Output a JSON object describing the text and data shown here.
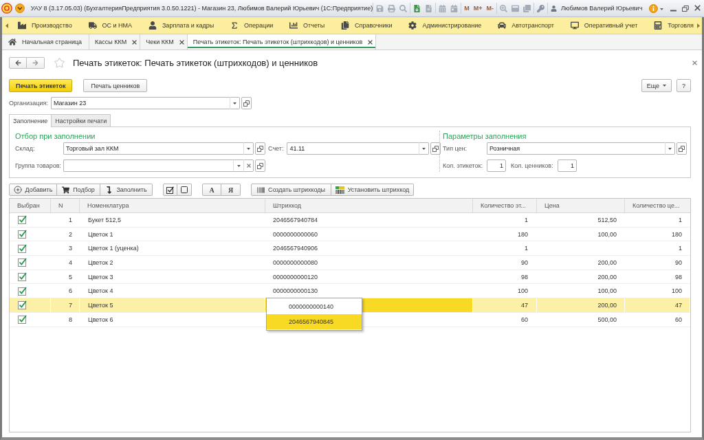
{
  "window": {
    "title": "УАУ 8 (3.17.05.03) (БухгалтерияПредприятия 3.0.50.1221) - Магазин 23, Любимов Валерий Юрьевич (1С:Предприятие)",
    "memory_buttons": [
      "M",
      "M+",
      "M-"
    ],
    "user": "Любимов Валерий Юрьевич"
  },
  "menu": [
    {
      "label": "Производство"
    },
    {
      "label": "ОС и НМА"
    },
    {
      "label": "Зарплата и кадры"
    },
    {
      "label": "Операции"
    },
    {
      "label": "Отчеты"
    },
    {
      "label": "Справочники"
    },
    {
      "label": "Администрирование"
    },
    {
      "label": "Автотранспорт"
    },
    {
      "label": "Оперативный учет"
    },
    {
      "label": "Торговля"
    }
  ],
  "tabs": [
    {
      "label": "Начальная страница",
      "kind": "home",
      "selected": false
    },
    {
      "label": "Кассы ККМ",
      "kind": "document",
      "selected": false
    },
    {
      "label": "Чеки ККМ",
      "kind": "document",
      "selected": false
    },
    {
      "label": "Печать этикеток: Печать этикеток (штрихкодов) и ценников",
      "kind": "document",
      "selected": true
    }
  ],
  "form": {
    "title": "Печать этикеток: Печать этикеток (штрихкодов) и ценников",
    "commands": [
      {
        "label": "Печать этикеток",
        "kind": "primary"
      },
      {
        "label": "Печать ценников",
        "kind": "default"
      }
    ],
    "more_button": "Еще",
    "help_button": "?",
    "organization": {
      "label": "Организация:",
      "value": "Магазин 23"
    },
    "tabs": [
      {
        "label": "Заполнение",
        "selected": true
      },
      {
        "label": "Настройки печати",
        "selected": false
      }
    ],
    "filter_group": {
      "title": "Отбор при заполнении",
      "warehouse": {
        "label": "Склад:",
        "value": "Торговый зал ККМ"
      },
      "account": {
        "label": "Счет:",
        "value": "41.11"
      },
      "product_group": {
        "label": "Группа товаров:"
      }
    },
    "params_group": {
      "title": "Параметры заполнения",
      "price_type": {
        "label": "Тип цен:",
        "value": "Розничная"
      },
      "label_count": {
        "label": "Кол. этикеток:",
        "value": "1"
      },
      "tag_count": {
        "label": "Кол. ценников:",
        "value": "1"
      }
    },
    "table_toolbar": {
      "edit_buttons": [
        "Добавить",
        "Подбор",
        "Заполнить"
      ],
      "sort_buttons": [
        "А",
        "Я"
      ],
      "barcode_buttons": [
        "Создать штрихкоды",
        "Установить штрихкод"
      ]
    },
    "table": {
      "columns": [
        "Выбран",
        "N",
        "Номенклатура",
        "Штрихкод",
        "Количество эт...",
        "Цена",
        "Количество це..."
      ],
      "rows": [
        {
          "checked": true,
          "n": "1",
          "name": "Букет 512,5",
          "barcode": "2046567940784",
          "label_qty": "1",
          "price": "512,50",
          "tag_qty": "1",
          "selected": false
        },
        {
          "checked": true,
          "n": "2",
          "name": "Цветок 1",
          "barcode": "0000000000060",
          "label_qty": "180",
          "price": "100,00",
          "tag_qty": "180",
          "selected": false
        },
        {
          "checked": true,
          "n": "3",
          "name": "Цветок 1 (уценка)",
          "barcode": "2046567940906",
          "label_qty": "1",
          "tag_qty": "1",
          "selected": false
        },
        {
          "checked": true,
          "n": "4",
          "name": "Цветок 2",
          "barcode": "0000000000080",
          "label_qty": "90",
          "price": "200,00",
          "tag_qty": "90",
          "selected": false
        },
        {
          "checked": true,
          "n": "5",
          "name": "Цветок 3",
          "barcode": "0000000000120",
          "label_qty": "98",
          "price": "200,00",
          "tag_qty": "98",
          "selected": false
        },
        {
          "checked": true,
          "n": "6",
          "name": "Цветок 4",
          "barcode": "0000000000130",
          "label_qty": "100",
          "price": "100,00",
          "tag_qty": "100",
          "selected": false
        },
        {
          "checked": true,
          "n": "7",
          "name": "Цветок 5",
          "barcode_options": [
            {
              "label": "0000000000140",
              "selected": false
            },
            {
              "label": "2046567940845",
              "selected": true
            }
          ],
          "label_qty": "47",
          "price": "200,00",
          "tag_qty": "47",
          "selected": true
        },
        {
          "checked": true,
          "n": "8",
          "name": "Цветок 6",
          "label_qty": "60",
          "price": "500,00",
          "tag_qty": "60",
          "selected": false
        }
      ]
    }
  }
}
